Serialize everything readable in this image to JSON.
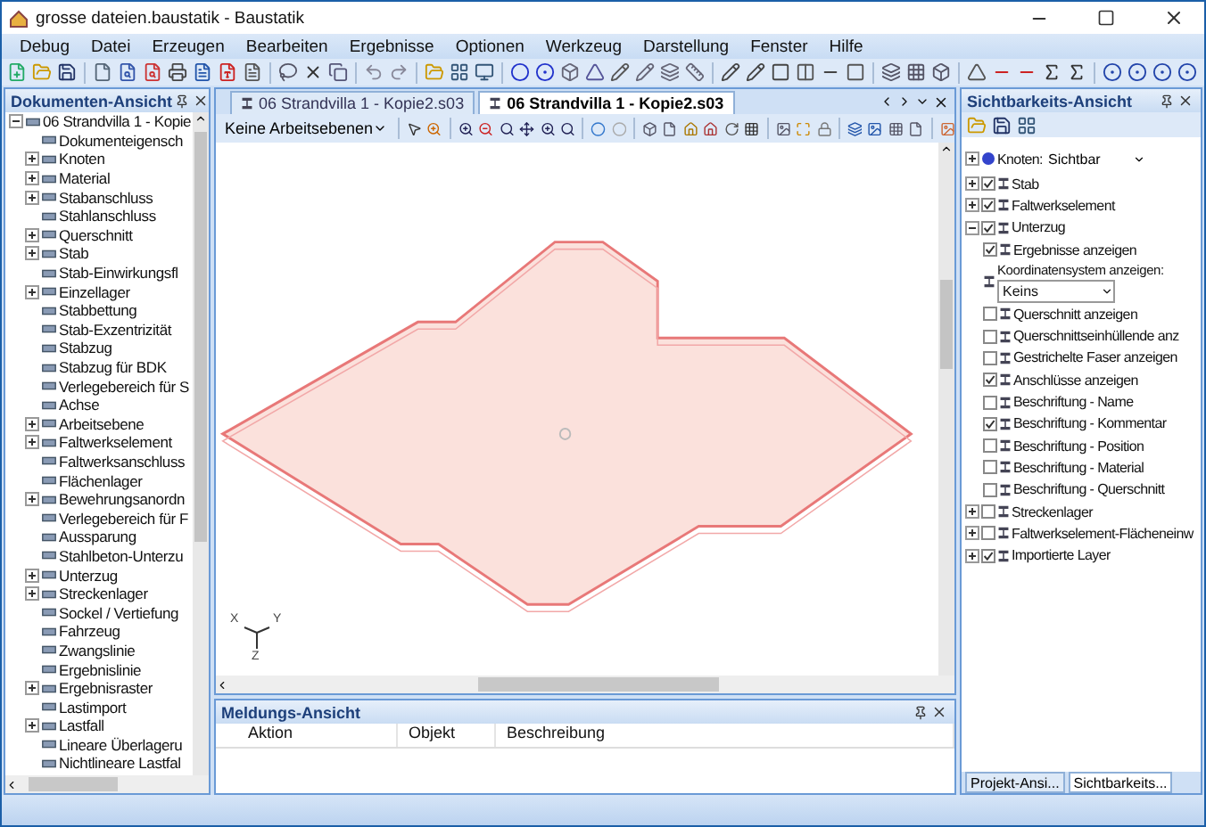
{
  "window": {
    "title": "grosse dateien.baustatik - Baustatik"
  },
  "menu": [
    "Debug",
    "Datei",
    "Erzeugen",
    "Bearbeiten",
    "Ergebnisse",
    "Optionen",
    "Werkzeug",
    "Darstellung",
    "Fenster",
    "Hilfe"
  ],
  "left_panel": {
    "title": "Dokumenten-Ansicht",
    "tree": [
      {
        "label": "06 Strandvilla 1  - Kopie",
        "collapsed": false,
        "children": [
          {
            "label": "Dokumenteigensch",
            "collapsed": false
          },
          {
            "label": "Knoten",
            "collapsed": true
          },
          {
            "label": "Material",
            "collapsed": true
          },
          {
            "label": "Stabanschluss",
            "collapsed": true
          },
          {
            "label": "Stahlanschluss",
            "collapsed": false
          },
          {
            "label": "Querschnitt",
            "collapsed": true
          },
          {
            "label": "Stab",
            "collapsed": true
          },
          {
            "label": "Stab-Einwirkungsfl",
            "collapsed": false
          },
          {
            "label": "Einzellager",
            "collapsed": true
          },
          {
            "label": "Stabbettung",
            "collapsed": false
          },
          {
            "label": "Stab-Exzentrizität",
            "collapsed": false
          },
          {
            "label": "Stabzug",
            "collapsed": false
          },
          {
            "label": "Stabzug für BDK",
            "collapsed": false
          },
          {
            "label": "Verlegebereich für S",
            "collapsed": false
          },
          {
            "label": "Achse",
            "collapsed": false
          },
          {
            "label": "Arbeitsebene",
            "collapsed": true
          },
          {
            "label": "Faltwerkselement",
            "collapsed": true
          },
          {
            "label": "Faltwerksanschluss",
            "collapsed": false
          },
          {
            "label": "Flächenlager",
            "collapsed": false
          },
          {
            "label": "Bewehrungsanordn",
            "collapsed": true
          },
          {
            "label": "Verlegebereich für F",
            "collapsed": false
          },
          {
            "label": "Aussparung",
            "collapsed": false
          },
          {
            "label": "Stahlbeton-Unterzu",
            "collapsed": false
          },
          {
            "label": "Unterzug",
            "collapsed": true
          },
          {
            "label": "Streckenlager",
            "collapsed": true
          },
          {
            "label": "Sockel / Vertiefung",
            "collapsed": false
          },
          {
            "label": "Fahrzeug",
            "collapsed": false
          },
          {
            "label": "Zwangslinie",
            "collapsed": false
          },
          {
            "label": "Ergebnislinie",
            "collapsed": false
          },
          {
            "label": "Ergebnisraster",
            "collapsed": true
          },
          {
            "label": "Lastimport",
            "collapsed": false
          },
          {
            "label": "Lastfall",
            "collapsed": true
          },
          {
            "label": "Lineare Überlageru",
            "collapsed": false
          },
          {
            "label": "Nichtlineare Lastfal",
            "collapsed": false
          }
        ]
      }
    ]
  },
  "editor": {
    "tabs": [
      {
        "label": "06 Strandvilla 1  - Kopie2.s03",
        "selected": false
      },
      {
        "label": "06 Strandvilla 1  - Kopie2.s03",
        "selected": true
      }
    ],
    "workplane_dropdown": "Keine Arbeitsebenen",
    "axes": [
      "X",
      "Y",
      "Z"
    ]
  },
  "messages": {
    "title": "Meldungs-Ansicht",
    "columns": [
      "Aktion",
      "Objekt",
      "Beschreibung"
    ]
  },
  "right_panel": {
    "title": "Sichtbarkeits-Ansicht",
    "node_row": {
      "label": "Knoten:",
      "value": "Sichtbar"
    },
    "items": [
      {
        "label": "Stab",
        "checked": true,
        "expanded": false
      },
      {
        "label": "Faltwerkselement",
        "checked": true,
        "expanded": false
      },
      {
        "label": "Unterzug",
        "checked": true,
        "expanded": true,
        "children": [
          {
            "kind": "checkbox",
            "label": "Ergebnisse anzeigen",
            "checked": true
          },
          {
            "kind": "select",
            "label": "Koordinatensystem anzeigen:",
            "value": "Keins"
          },
          {
            "kind": "checkbox",
            "label": "Querschnitt anzeigen",
            "checked": false
          },
          {
            "kind": "checkbox",
            "label": "Querschnittseinhüllende anz",
            "checked": false
          },
          {
            "kind": "checkbox",
            "label": "Gestrichelte Faser anzeigen",
            "checked": false
          },
          {
            "kind": "checkbox",
            "label": "Anschlüsse anzeigen",
            "checked": true
          },
          {
            "kind": "checkbox",
            "label": "Beschriftung - Name",
            "checked": false
          },
          {
            "kind": "checkbox",
            "label": "Beschriftung - Kommentar",
            "checked": true
          },
          {
            "kind": "checkbox",
            "label": "Beschriftung - Position",
            "checked": false
          },
          {
            "kind": "checkbox",
            "label": "Beschriftung - Material",
            "checked": false
          },
          {
            "kind": "checkbox",
            "label": "Beschriftung - Querschnitt",
            "checked": false
          }
        ]
      },
      {
        "label": "Streckenlager",
        "checked": false,
        "expanded": false
      },
      {
        "label": "Faltwerkselement-Flächeneinw",
        "checked": false,
        "expanded": false
      },
      {
        "label": "Importierte Layer",
        "checked": true,
        "expanded": false
      }
    ],
    "bottom_tabs": [
      {
        "label": "Projekt-Ansi...",
        "selected": false
      },
      {
        "label": "Sichtbarkeits...",
        "selected": true
      }
    ]
  }
}
